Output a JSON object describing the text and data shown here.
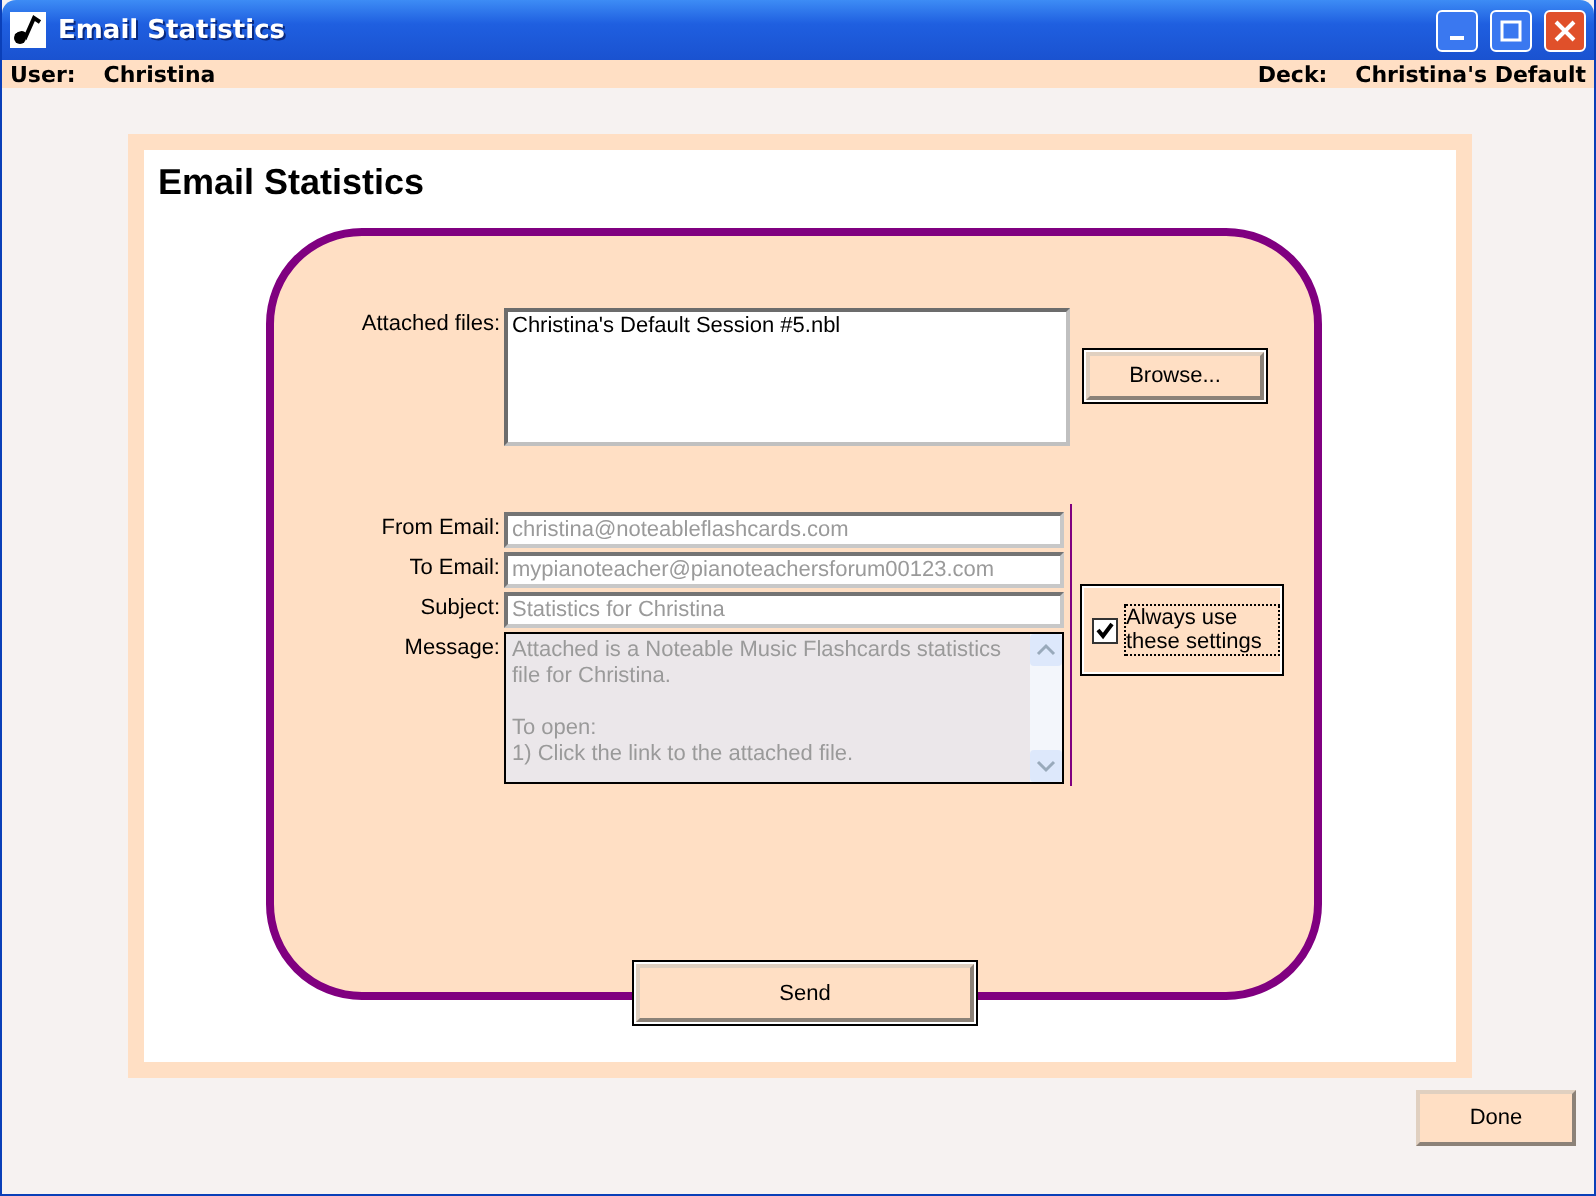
{
  "window": {
    "title": "Email Statistics",
    "controls": [
      {
        "kind": "minimize"
      },
      {
        "kind": "maximize"
      },
      {
        "kind": "close"
      }
    ]
  },
  "info_bar": {
    "user_label": "User:",
    "user": "Christina",
    "deck_label": "Deck:",
    "deck": "Christina's Default"
  },
  "heading": "Email Statistics",
  "attachments": {
    "label": "Attached files:",
    "files": [
      "Christina's Default Session #5.nbl"
    ],
    "browse_button": "Browse..."
  },
  "fields": [
    {
      "label": "From Email:",
      "value": "christina@noteableflashcards.com",
      "disabled": true
    },
    {
      "label": "To Email:",
      "value": "mypianoteacher@pianoteachersforum00123.com",
      "disabled": true
    },
    {
      "label": "Subject:",
      "value": "Statistics for Christina",
      "disabled": true
    }
  ],
  "message": {
    "label": "Message:",
    "paragraphs": [
      [
        "Attached is a Noteable Music Flashcards statistics file for Christina."
      ],
      [
        "To open:",
        "1) Click the link to the attached file."
      ]
    ],
    "disabled": true
  },
  "always_use": {
    "label": "Always use these settings",
    "checked": true
  },
  "send_button": "Send",
  "done_button": "Done"
}
